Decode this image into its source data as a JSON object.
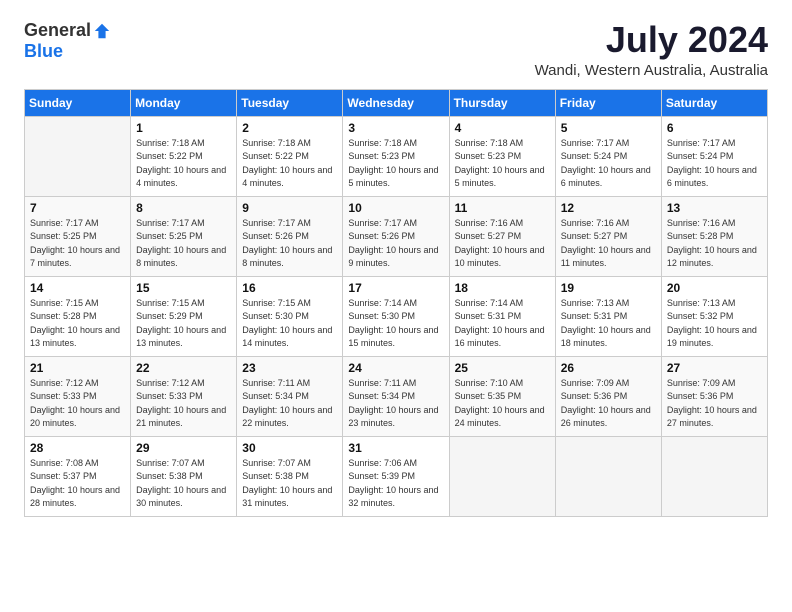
{
  "header": {
    "logo_general": "General",
    "logo_blue": "Blue",
    "month": "July 2024",
    "location": "Wandi, Western Australia, Australia"
  },
  "weekdays": [
    "Sunday",
    "Monday",
    "Tuesday",
    "Wednesday",
    "Thursday",
    "Friday",
    "Saturday"
  ],
  "weeks": [
    [
      {
        "day": "",
        "sunrise": "",
        "sunset": "",
        "daylight": ""
      },
      {
        "day": "1",
        "sunrise": "Sunrise: 7:18 AM",
        "sunset": "Sunset: 5:22 PM",
        "daylight": "Daylight: 10 hours and 4 minutes."
      },
      {
        "day": "2",
        "sunrise": "Sunrise: 7:18 AM",
        "sunset": "Sunset: 5:22 PM",
        "daylight": "Daylight: 10 hours and 4 minutes."
      },
      {
        "day": "3",
        "sunrise": "Sunrise: 7:18 AM",
        "sunset": "Sunset: 5:23 PM",
        "daylight": "Daylight: 10 hours and 5 minutes."
      },
      {
        "day": "4",
        "sunrise": "Sunrise: 7:18 AM",
        "sunset": "Sunset: 5:23 PM",
        "daylight": "Daylight: 10 hours and 5 minutes."
      },
      {
        "day": "5",
        "sunrise": "Sunrise: 7:17 AM",
        "sunset": "Sunset: 5:24 PM",
        "daylight": "Daylight: 10 hours and 6 minutes."
      },
      {
        "day": "6",
        "sunrise": "Sunrise: 7:17 AM",
        "sunset": "Sunset: 5:24 PM",
        "daylight": "Daylight: 10 hours and 6 minutes."
      }
    ],
    [
      {
        "day": "7",
        "sunrise": "Sunrise: 7:17 AM",
        "sunset": "Sunset: 5:25 PM",
        "daylight": "Daylight: 10 hours and 7 minutes."
      },
      {
        "day": "8",
        "sunrise": "Sunrise: 7:17 AM",
        "sunset": "Sunset: 5:25 PM",
        "daylight": "Daylight: 10 hours and 8 minutes."
      },
      {
        "day": "9",
        "sunrise": "Sunrise: 7:17 AM",
        "sunset": "Sunset: 5:26 PM",
        "daylight": "Daylight: 10 hours and 8 minutes."
      },
      {
        "day": "10",
        "sunrise": "Sunrise: 7:17 AM",
        "sunset": "Sunset: 5:26 PM",
        "daylight": "Daylight: 10 hours and 9 minutes."
      },
      {
        "day": "11",
        "sunrise": "Sunrise: 7:16 AM",
        "sunset": "Sunset: 5:27 PM",
        "daylight": "Daylight: 10 hours and 10 minutes."
      },
      {
        "day": "12",
        "sunrise": "Sunrise: 7:16 AM",
        "sunset": "Sunset: 5:27 PM",
        "daylight": "Daylight: 10 hours and 11 minutes."
      },
      {
        "day": "13",
        "sunrise": "Sunrise: 7:16 AM",
        "sunset": "Sunset: 5:28 PM",
        "daylight": "Daylight: 10 hours and 12 minutes."
      }
    ],
    [
      {
        "day": "14",
        "sunrise": "Sunrise: 7:15 AM",
        "sunset": "Sunset: 5:28 PM",
        "daylight": "Daylight: 10 hours and 13 minutes."
      },
      {
        "day": "15",
        "sunrise": "Sunrise: 7:15 AM",
        "sunset": "Sunset: 5:29 PM",
        "daylight": "Daylight: 10 hours and 13 minutes."
      },
      {
        "day": "16",
        "sunrise": "Sunrise: 7:15 AM",
        "sunset": "Sunset: 5:30 PM",
        "daylight": "Daylight: 10 hours and 14 minutes."
      },
      {
        "day": "17",
        "sunrise": "Sunrise: 7:14 AM",
        "sunset": "Sunset: 5:30 PM",
        "daylight": "Daylight: 10 hours and 15 minutes."
      },
      {
        "day": "18",
        "sunrise": "Sunrise: 7:14 AM",
        "sunset": "Sunset: 5:31 PM",
        "daylight": "Daylight: 10 hours and 16 minutes."
      },
      {
        "day": "19",
        "sunrise": "Sunrise: 7:13 AM",
        "sunset": "Sunset: 5:31 PM",
        "daylight": "Daylight: 10 hours and 18 minutes."
      },
      {
        "day": "20",
        "sunrise": "Sunrise: 7:13 AM",
        "sunset": "Sunset: 5:32 PM",
        "daylight": "Daylight: 10 hours and 19 minutes."
      }
    ],
    [
      {
        "day": "21",
        "sunrise": "Sunrise: 7:12 AM",
        "sunset": "Sunset: 5:33 PM",
        "daylight": "Daylight: 10 hours and 20 minutes."
      },
      {
        "day": "22",
        "sunrise": "Sunrise: 7:12 AM",
        "sunset": "Sunset: 5:33 PM",
        "daylight": "Daylight: 10 hours and 21 minutes."
      },
      {
        "day": "23",
        "sunrise": "Sunrise: 7:11 AM",
        "sunset": "Sunset: 5:34 PM",
        "daylight": "Daylight: 10 hours and 22 minutes."
      },
      {
        "day": "24",
        "sunrise": "Sunrise: 7:11 AM",
        "sunset": "Sunset: 5:34 PM",
        "daylight": "Daylight: 10 hours and 23 minutes."
      },
      {
        "day": "25",
        "sunrise": "Sunrise: 7:10 AM",
        "sunset": "Sunset: 5:35 PM",
        "daylight": "Daylight: 10 hours and 24 minutes."
      },
      {
        "day": "26",
        "sunrise": "Sunrise: 7:09 AM",
        "sunset": "Sunset: 5:36 PM",
        "daylight": "Daylight: 10 hours and 26 minutes."
      },
      {
        "day": "27",
        "sunrise": "Sunrise: 7:09 AM",
        "sunset": "Sunset: 5:36 PM",
        "daylight": "Daylight: 10 hours and 27 minutes."
      }
    ],
    [
      {
        "day": "28",
        "sunrise": "Sunrise: 7:08 AM",
        "sunset": "Sunset: 5:37 PM",
        "daylight": "Daylight: 10 hours and 28 minutes."
      },
      {
        "day": "29",
        "sunrise": "Sunrise: 7:07 AM",
        "sunset": "Sunset: 5:38 PM",
        "daylight": "Daylight: 10 hours and 30 minutes."
      },
      {
        "day": "30",
        "sunrise": "Sunrise: 7:07 AM",
        "sunset": "Sunset: 5:38 PM",
        "daylight": "Daylight: 10 hours and 31 minutes."
      },
      {
        "day": "31",
        "sunrise": "Sunrise: 7:06 AM",
        "sunset": "Sunset: 5:39 PM",
        "daylight": "Daylight: 10 hours and 32 minutes."
      },
      {
        "day": "",
        "sunrise": "",
        "sunset": "",
        "daylight": ""
      },
      {
        "day": "",
        "sunrise": "",
        "sunset": "",
        "daylight": ""
      },
      {
        "day": "",
        "sunrise": "",
        "sunset": "",
        "daylight": ""
      }
    ]
  ]
}
